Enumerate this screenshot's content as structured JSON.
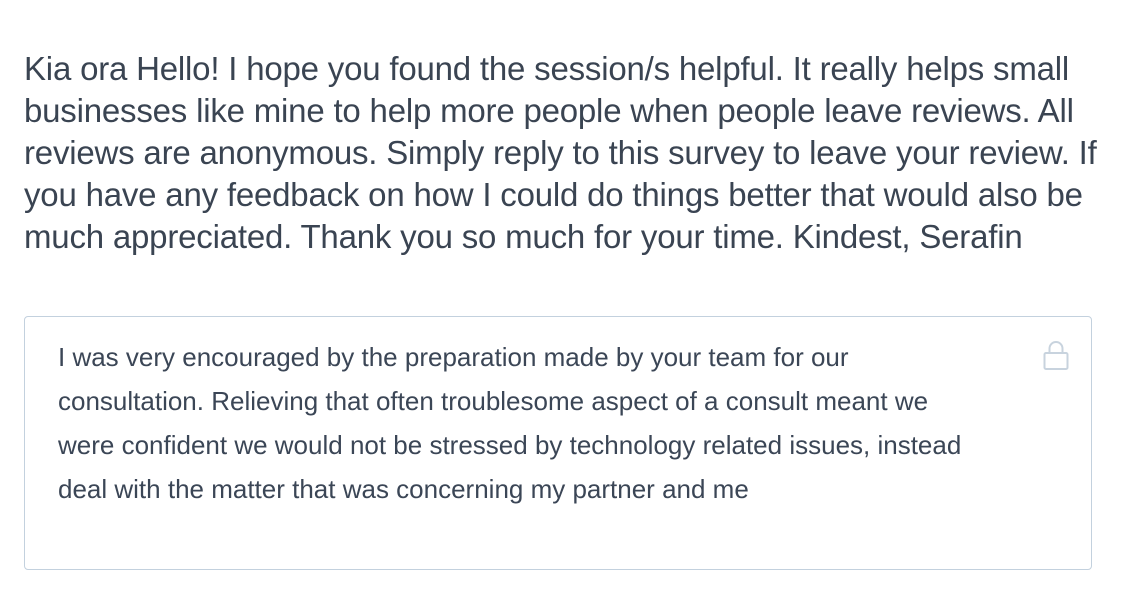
{
  "question": {
    "text": "Kia ora Hello! I hope you found the session/s helpful. It really helps small businesses like mine to help more people when people leave reviews. All reviews are anonymous. Simply reply to this survey to leave your review. If you have any feedback on how I could do things better that would also be much appreciated. Thank you so much for your time. Kindest, Serafin"
  },
  "answer": {
    "text": "I was very encouraged by the preparation made by your team for our consultation. Relieving that often troublesome aspect of a consult meant we were confident we would not be stressed by technology related issues, instead deal with the matter that was concerning my partner and me",
    "locked": true,
    "icon": "lock-icon"
  },
  "colors": {
    "text": "#3a4452",
    "border": "#c3d1de",
    "icon": "#c8d3de"
  }
}
